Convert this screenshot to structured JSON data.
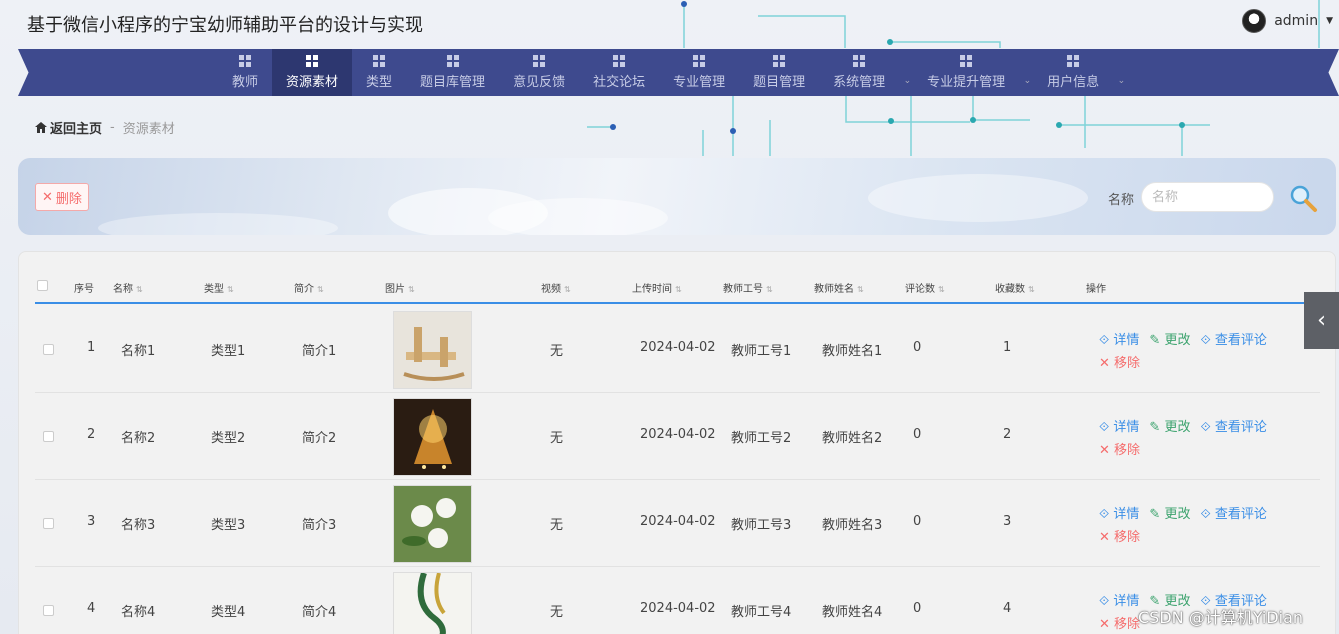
{
  "app": {
    "title": "基于微信小程序的宁宝幼师辅助平台的设计与实现",
    "user": "admin"
  },
  "nav": [
    {
      "label": "教师",
      "active": false
    },
    {
      "label": "资源素材",
      "active": true
    },
    {
      "label": "类型",
      "active": false
    },
    {
      "label": "题目库管理",
      "active": false
    },
    {
      "label": "意见反馈",
      "active": false
    },
    {
      "label": "社交论坛",
      "active": false
    },
    {
      "label": "专业管理",
      "active": false
    },
    {
      "label": "题目管理",
      "active": false
    },
    {
      "label": "系统管理",
      "active": false,
      "dropdown": true
    },
    {
      "label": "专业提升管理",
      "active": false,
      "dropdown": true
    },
    {
      "label": "用户信息",
      "active": false,
      "dropdown": true
    }
  ],
  "breadcrumb": {
    "home": "返回主页",
    "sep": "-",
    "current": "资源素材"
  },
  "toolbar": {
    "delete_label": "删除",
    "search_label": "名称",
    "search_placeholder": "名称"
  },
  "table": {
    "headers": [
      "序号",
      "名称",
      "类型",
      "简介",
      "图片",
      "视频",
      "上传时间",
      "教师工号",
      "教师姓名",
      "评论数",
      "收藏数",
      "操作"
    ],
    "rows": [
      {
        "idx": "1",
        "name": "名称1",
        "type": "类型1",
        "intro": "简介1",
        "video": "无",
        "time": "2024-04-02",
        "tno": "教师工号1",
        "tname": "教师姓名1",
        "comments": "0",
        "favs": "1"
      },
      {
        "idx": "2",
        "name": "名称2",
        "type": "类型2",
        "intro": "简介2",
        "video": "无",
        "time": "2024-04-02",
        "tno": "教师工号2",
        "tname": "教师姓名2",
        "comments": "0",
        "favs": "2"
      },
      {
        "idx": "3",
        "name": "名称3",
        "type": "类型3",
        "intro": "简介3",
        "video": "无",
        "time": "2024-04-02",
        "tno": "教师工号3",
        "tname": "教师姓名3",
        "comments": "0",
        "favs": "3"
      },
      {
        "idx": "4",
        "name": "名称4",
        "type": "类型4",
        "intro": "简介4",
        "video": "无",
        "time": "2024-04-02",
        "tno": "教师工号4",
        "tname": "教师姓名4",
        "comments": "0",
        "favs": "4"
      }
    ],
    "actions": {
      "detail": "详情",
      "edit": "更改",
      "comments": "查看评论",
      "remove": "移除"
    }
  },
  "watermark": "CSDN @计算机YiDian",
  "colors": {
    "nav": "#3e4a8e",
    "nav_active": "#2d3770",
    "accent": "#3a8ee6",
    "danger": "#f56c6c",
    "success": "#3ca36e"
  }
}
